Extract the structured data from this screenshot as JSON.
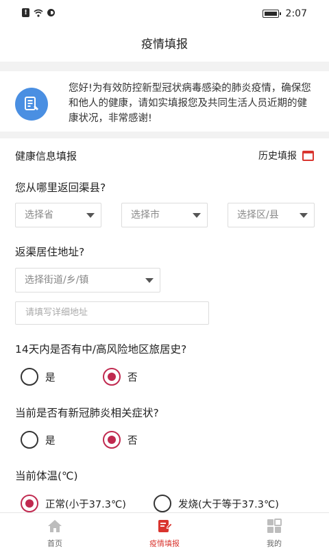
{
  "status_bar": {
    "time": "2:07",
    "alert_glyph": "!"
  },
  "header": {
    "title": "疫情填报"
  },
  "notice": {
    "icon": "form-document-icon",
    "text": "您好!为有效防控新型冠状病毒感染的肺炎疫情，确保您和他人的健康，请如实填报您及共同生活人员近期的健康状况，非常感谢!"
  },
  "health_section": {
    "title": "健康信息填报",
    "history_label": "历史填报"
  },
  "return_from": {
    "question": "您从哪里返回渠县?",
    "province_placeholder": "选择省",
    "city_placeholder": "选择市",
    "district_placeholder": "选择区/县"
  },
  "address": {
    "question": "返渠居住地址?",
    "street_placeholder": "选择街道/乡/镇",
    "detail_placeholder": "请填写详细地址"
  },
  "travel_history": {
    "question": "14天内是否有中/高风险地区旅居史?",
    "yes": "是",
    "no": "否",
    "selected": "否"
  },
  "symptoms": {
    "question": "当前是否有新冠肺炎相关症状?",
    "yes": "是",
    "no": "否",
    "selected": "否"
  },
  "temperature": {
    "question": "当前体温(℃)",
    "normal": "正常(小于37.3℃)",
    "fever": "发烧(大于等于37.3℃)",
    "selected": "正常(小于37.3℃)"
  },
  "tabs": [
    {
      "label": "首页",
      "icon": "home-icon"
    },
    {
      "label": "疫情填报",
      "icon": "edit-report-icon",
      "active": true
    },
    {
      "label": "我的",
      "icon": "grid-icon"
    }
  ],
  "colors": {
    "accent": "#d9342e",
    "radio_selected": "#c0294f",
    "notice_icon_bg": "#4a8fe2"
  }
}
